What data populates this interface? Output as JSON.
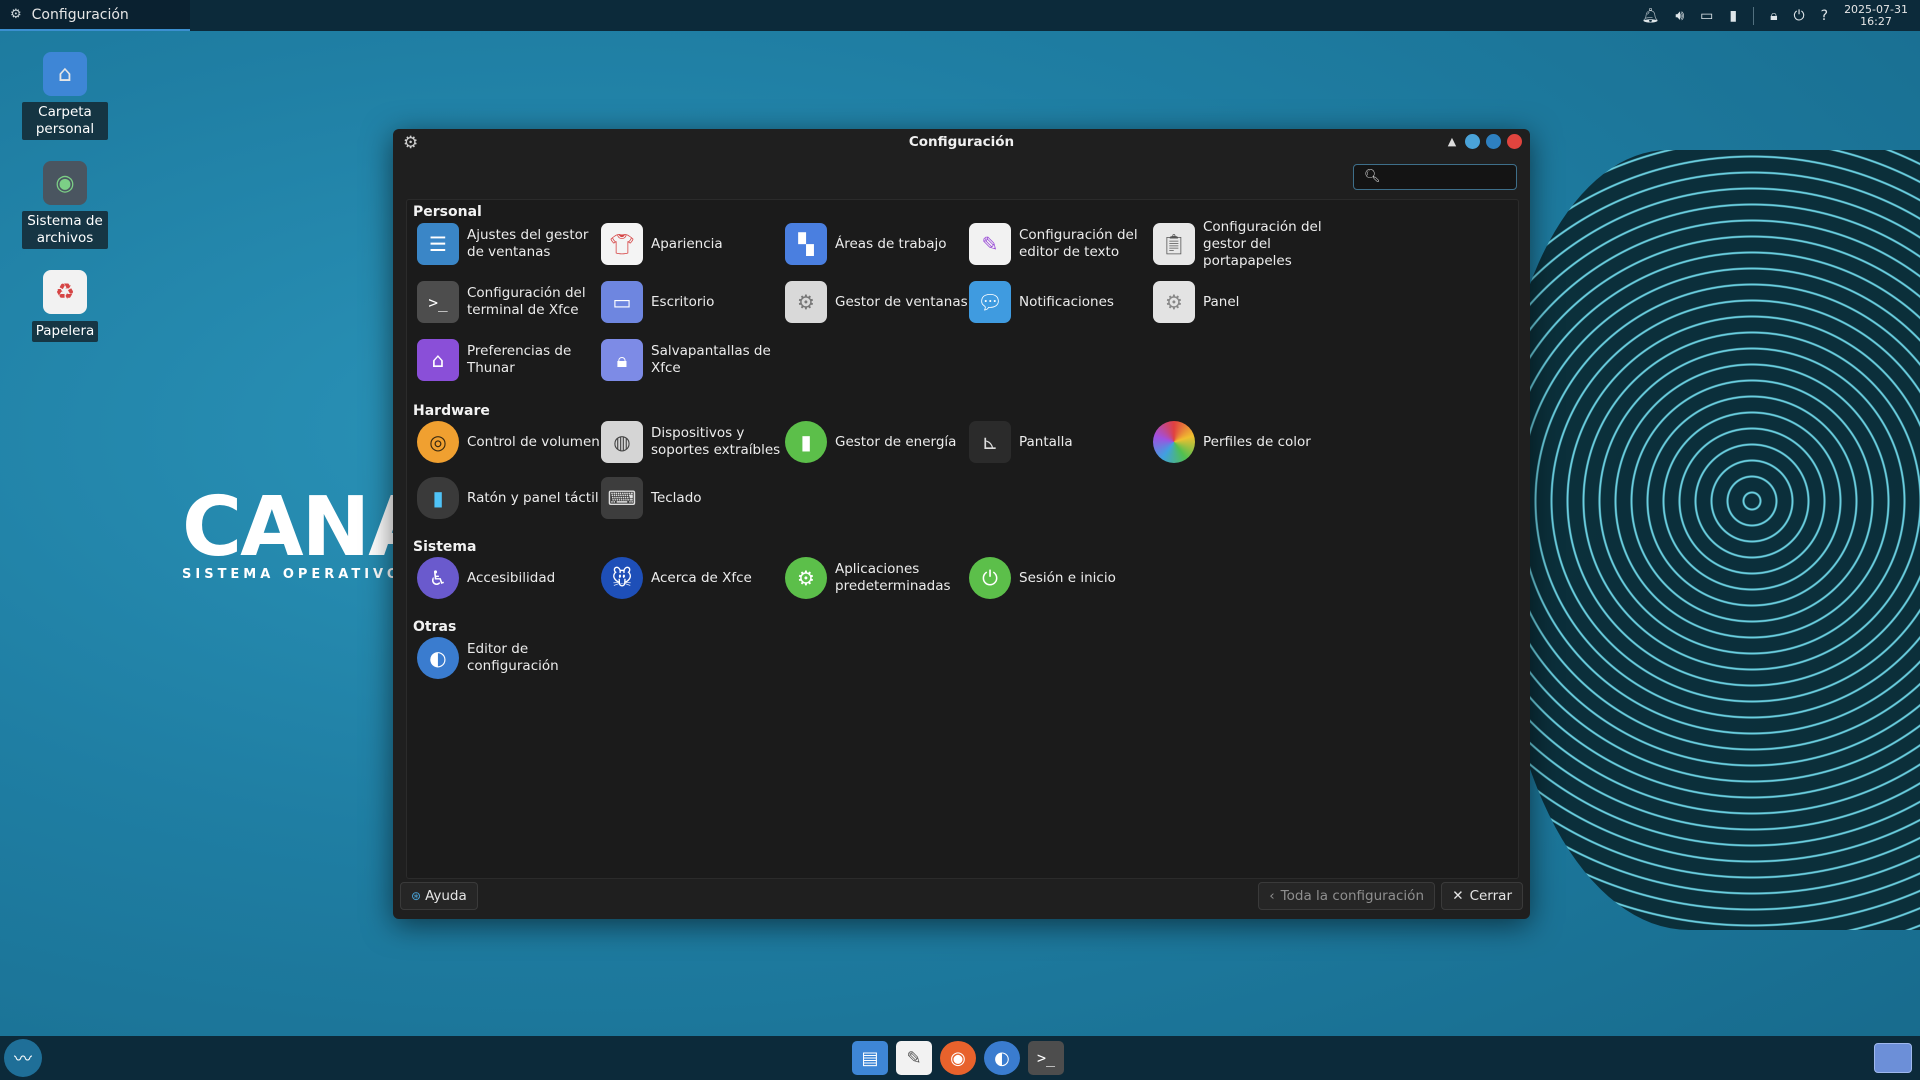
{
  "top_panel": {
    "task_title": "Configuración",
    "clock_date": "2025-07-31",
    "clock_time": "16:27",
    "tray_icons": [
      "bell-icon",
      "volume-icon",
      "display-icon",
      "battery-icon",
      "lock-icon",
      "power-icon",
      "help-icon"
    ]
  },
  "desktop": {
    "icons": [
      {
        "label": "Carpeta personal",
        "icon": "home-folder-icon"
      },
      {
        "label": "Sistema de archivos",
        "icon": "drive-icon"
      },
      {
        "label": "Papelera",
        "icon": "trash-icon"
      }
    ],
    "wallpaper_logo": {
      "big": "CANA",
      "small": "SISTEMA OPERATIVO"
    }
  },
  "window": {
    "title": "Configuración",
    "search_placeholder": "",
    "sections": {
      "personal": {
        "title": "Personal",
        "items": [
          "Ajustes del gestor de ventanas",
          "Apariencia",
          "Áreas de trabajo",
          "Configuración del editor de texto",
          "Configuración del gestor del portapapeles",
          "Configuración del terminal de Xfce",
          "Escritorio",
          "Gestor de ventanas",
          "Notificaciones",
          "Panel",
          "Preferencias de Thunar",
          "Salvapantallas de Xfce"
        ]
      },
      "hardware": {
        "title": "Hardware",
        "items": [
          "Control de volumen",
          "Dispositivos y soportes extraíbles",
          "Gestor de energía",
          "Pantalla",
          "Perfiles de color",
          "Ratón y panel táctil",
          "Teclado"
        ]
      },
      "sistema": {
        "title": "Sistema",
        "items": [
          "Accesibilidad",
          "Acerca de Xfce",
          "Aplicaciones predeterminadas",
          "Sesión e inicio"
        ]
      },
      "otras": {
        "title": "Otras",
        "items": [
          "Editor de configuración"
        ]
      }
    },
    "footer": {
      "help": "Ayuda",
      "all_settings": "Toda la configuración",
      "close": "Cerrar"
    }
  },
  "taskbar": {
    "launchers": [
      "file-manager-icon",
      "text-editor-icon",
      "firefox-icon",
      "settings-toggle-icon",
      "terminal-icon"
    ]
  },
  "colors": {
    "accent": "#3b8fd0",
    "close_button": "#e0443e",
    "panel_bg": "#0c2a3a"
  }
}
